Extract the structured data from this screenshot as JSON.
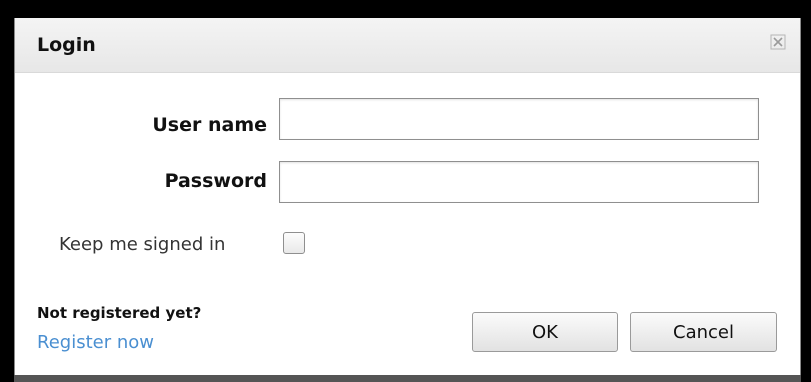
{
  "dialog": {
    "title": "Login",
    "close_icon": "close-icon"
  },
  "form": {
    "username_label": "User name",
    "username_value": "",
    "password_label": "Password",
    "password_value": "",
    "keep_signed_in_label": "Keep me signed in",
    "keep_signed_in_checked": false
  },
  "footer": {
    "not_registered_text": "Not registered yet?",
    "register_link": "Register now",
    "ok_label": "OK",
    "cancel_label": "Cancel"
  },
  "colors": {
    "link": "#4a8fd1",
    "frame": "#000000"
  }
}
